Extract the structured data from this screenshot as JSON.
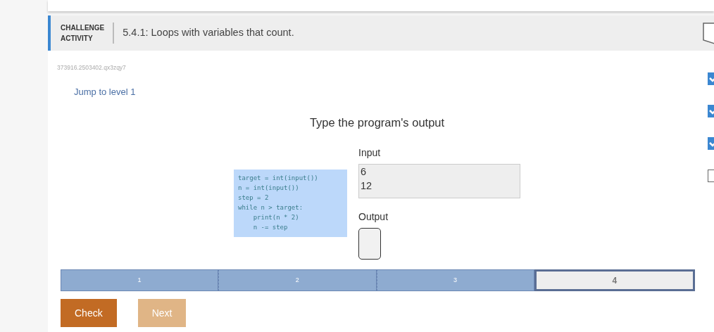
{
  "header": {
    "label_line1": "CHALLENGE",
    "label_line2": "ACTIVITY",
    "title": "5.4.1: Loops with variables that count."
  },
  "activity_id": "373916.2503402.qx3zqy7",
  "jump_link": "Jump to level 1",
  "prompt": "Type the program's output",
  "code_lines": [
    "target = int(input())",
    "n = int(input())",
    "step = 2",
    "while n > target:",
    "    print(n * 2)",
    "    n -= step"
  ],
  "input": {
    "label": "Input",
    "lines": [
      "6",
      "12"
    ]
  },
  "output": {
    "label": "Output"
  },
  "levels": [
    {
      "label": "1",
      "completed": true,
      "selected": false
    },
    {
      "label": "2",
      "completed": true,
      "selected": false
    },
    {
      "label": "3",
      "completed": true,
      "selected": false
    },
    {
      "label": "4",
      "completed": false,
      "selected": true
    }
  ],
  "level_checks": [
    {
      "checked": true
    },
    {
      "checked": true
    },
    {
      "checked": true
    },
    {
      "checked": false
    }
  ],
  "buttons": [
    {
      "label": "Check",
      "disabled": false
    },
    {
      "label": "Next",
      "disabled": true
    }
  ]
}
